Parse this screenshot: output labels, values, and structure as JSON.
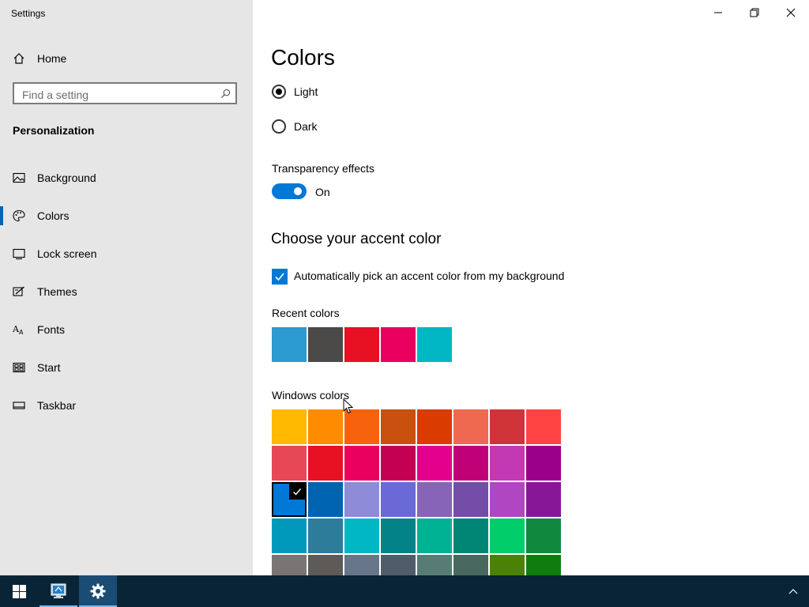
{
  "window": {
    "title": "Settings"
  },
  "sidebar": {
    "home_label": "Home",
    "search_placeholder": "Find a setting",
    "section_title": "Personalization",
    "items": [
      {
        "label": "Background",
        "icon": "picture-icon"
      },
      {
        "label": "Colors",
        "icon": "palette-icon",
        "active": true
      },
      {
        "label": "Lock screen",
        "icon": "lock-screen-icon"
      },
      {
        "label": "Themes",
        "icon": "themes-icon"
      },
      {
        "label": "Fonts",
        "icon": "fonts-icon"
      },
      {
        "label": "Start",
        "icon": "start-icon"
      },
      {
        "label": "Taskbar",
        "icon": "taskbar-icon"
      }
    ]
  },
  "main": {
    "title": "Colors",
    "mode_options": [
      {
        "label": "Light",
        "selected": true
      },
      {
        "label": "Dark",
        "selected": false
      }
    ],
    "transparency": {
      "label": "Transparency effects",
      "state_label": "On"
    },
    "accent_heading": "Choose your accent color",
    "auto_pick_label": "Automatically pick an accent color from my background",
    "recent_label": "Recent colors",
    "recent_colors": [
      "#2b9bd1",
      "#4c4a48",
      "#e81123",
      "#ea005e",
      "#00b7c3"
    ],
    "windows_label": "Windows colors",
    "windows_colors": [
      "#ffb900",
      "#ff8c00",
      "#f7630c",
      "#ca5010",
      "#da3b01",
      "#ef6950",
      "#d13438",
      "#ff4343",
      "#e74856",
      "#e81123",
      "#ea005e",
      "#c30052",
      "#e3008c",
      "#bf0077",
      "#c239b3",
      "#9a0089",
      "#0078d7",
      "#0063b1",
      "#8e8cd8",
      "#6b69d6",
      "#8764b8",
      "#744da9",
      "#b146c2",
      "#881798",
      "#0099bc",
      "#2d7d9a",
      "#00b7c3",
      "#038387",
      "#00b294",
      "#018574",
      "#00cc6a",
      "#10893e",
      "#7a7574",
      "#5d5a58",
      "#68768a",
      "#515c6b",
      "#567c73",
      "#486860",
      "#498205",
      "#107c10"
    ],
    "selected_color_index": 16
  },
  "colors": {
    "accent": "#0078d7",
    "sidebar_bg": "#e6e6e6",
    "taskbar_bg": "#0a2437"
  }
}
